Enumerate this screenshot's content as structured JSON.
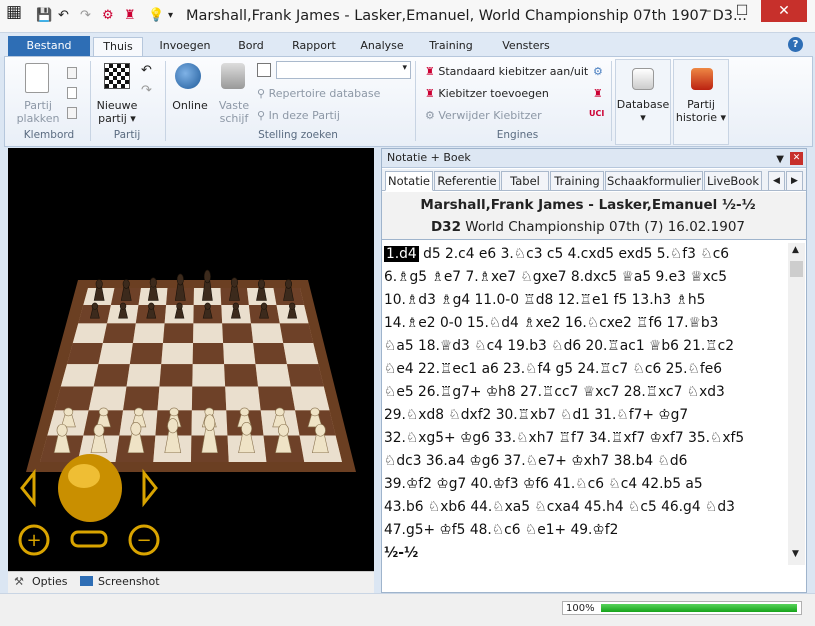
{
  "window": {
    "title": "Marshall,Frank James - Lasker,Emanuel, World Championship 07th 1907  D3...",
    "minimize": "–",
    "maximize": "☐",
    "close": "✕"
  },
  "ribbon_tabs": {
    "file": "Bestand",
    "tabs": [
      "Thuis",
      "Invoegen",
      "Bord",
      "Rapport",
      "Analyse",
      "Training",
      "Vensters"
    ],
    "active": "Thuis",
    "help": "?"
  },
  "ribbon": {
    "klembord": {
      "paste": "Partij\nplakken",
      "group": "Klembord"
    },
    "partij": {
      "new": "Nieuwe\npartij ▾",
      "group": "Partij"
    },
    "stelling": {
      "online": "Online",
      "vaste": "Vaste\nschijf",
      "repertoire": "Repertoire database",
      "in_partij": "In deze Partij",
      "group": "Stelling zoeken"
    },
    "engines": {
      "standaard": "Standaard kiebitzer aan/uit",
      "toevoegen": "Kiebitzer toevoegen",
      "verwijder": "Verwijder Kiebitzer",
      "group": "Engines",
      "uci": "UCI"
    },
    "database": "Database\n▾",
    "historie": "Partij\nhistorie ▾"
  },
  "board_panel": {
    "options": "Opties",
    "screenshot": "Screenshot"
  },
  "notation_panel": {
    "title": "Notatie + Boek",
    "tabs": [
      "Notatie",
      "Referentie",
      "Tabel",
      "Training",
      "Schaakformulier",
      "LiveBook"
    ],
    "active_tab": "Notatie",
    "players": "Marshall,Frank James - Lasker,Emanuel  ½-½",
    "eco": "D32",
    "event": "World Championship 07th (7) 16.02.1907",
    "current_move": "1.d4",
    "move_lines": [
      "d5  2.c4  e6  3.♘c3  c5  4.cxd5  exd5  5.♘f3  ♘c6",
      "6.♗g5  ♗e7  7.♗xe7  ♘gxe7  8.dxc5  ♕a5  9.e3  ♕xc5",
      "10.♗d3  ♗g4  11.0-0  ♖d8  12.♖e1  f5  13.h3  ♗h5",
      "14.♗e2  0-0  15.♘d4  ♗xe2  16.♘cxe2  ♖f6  17.♕b3",
      "♘a5  18.♕d3  ♘c4  19.b3  ♘d6  20.♖ac1  ♕b6  21.♖c2",
      "♘e4  22.♖ec1  a6  23.♘f4  g5  24.♖c7  ♘c6  25.♘fe6",
      "♘e5  26.♖g7+  ♔h8  27.♖cc7  ♕xc7  28.♖xc7  ♘xd3",
      "29.♘xd8  ♘dxf2  30.♖xb7  ♘d1  31.♘f7+  ♔g7",
      "32.♘xg5+  ♔g6  33.♘xh7  ♖f7  34.♖xf7  ♔xf7  35.♘xf5",
      "♘dc3  36.a4  ♔g6  37.♘e7+  ♔xh7  38.b4  ♘d6",
      "39.♔f2  ♔g7  40.♔f3  ♔f6  41.♘c6  ♘c4  42.b5  a5",
      "43.b6  ♘xb6  44.♘xa5  ♘cxa4  45.h4  ♘c5  46.g4  ♘d3",
      "47.g5+  ♔f5  48.♘c6  ♘e1+  49.♔f2"
    ],
    "result": "½-½"
  },
  "status": {
    "progress_text": "100%",
    "progress": 1.0
  },
  "colors": {
    "accent": "#2e6eb5",
    "close": "#c7302b",
    "progress": "#16a31a"
  }
}
